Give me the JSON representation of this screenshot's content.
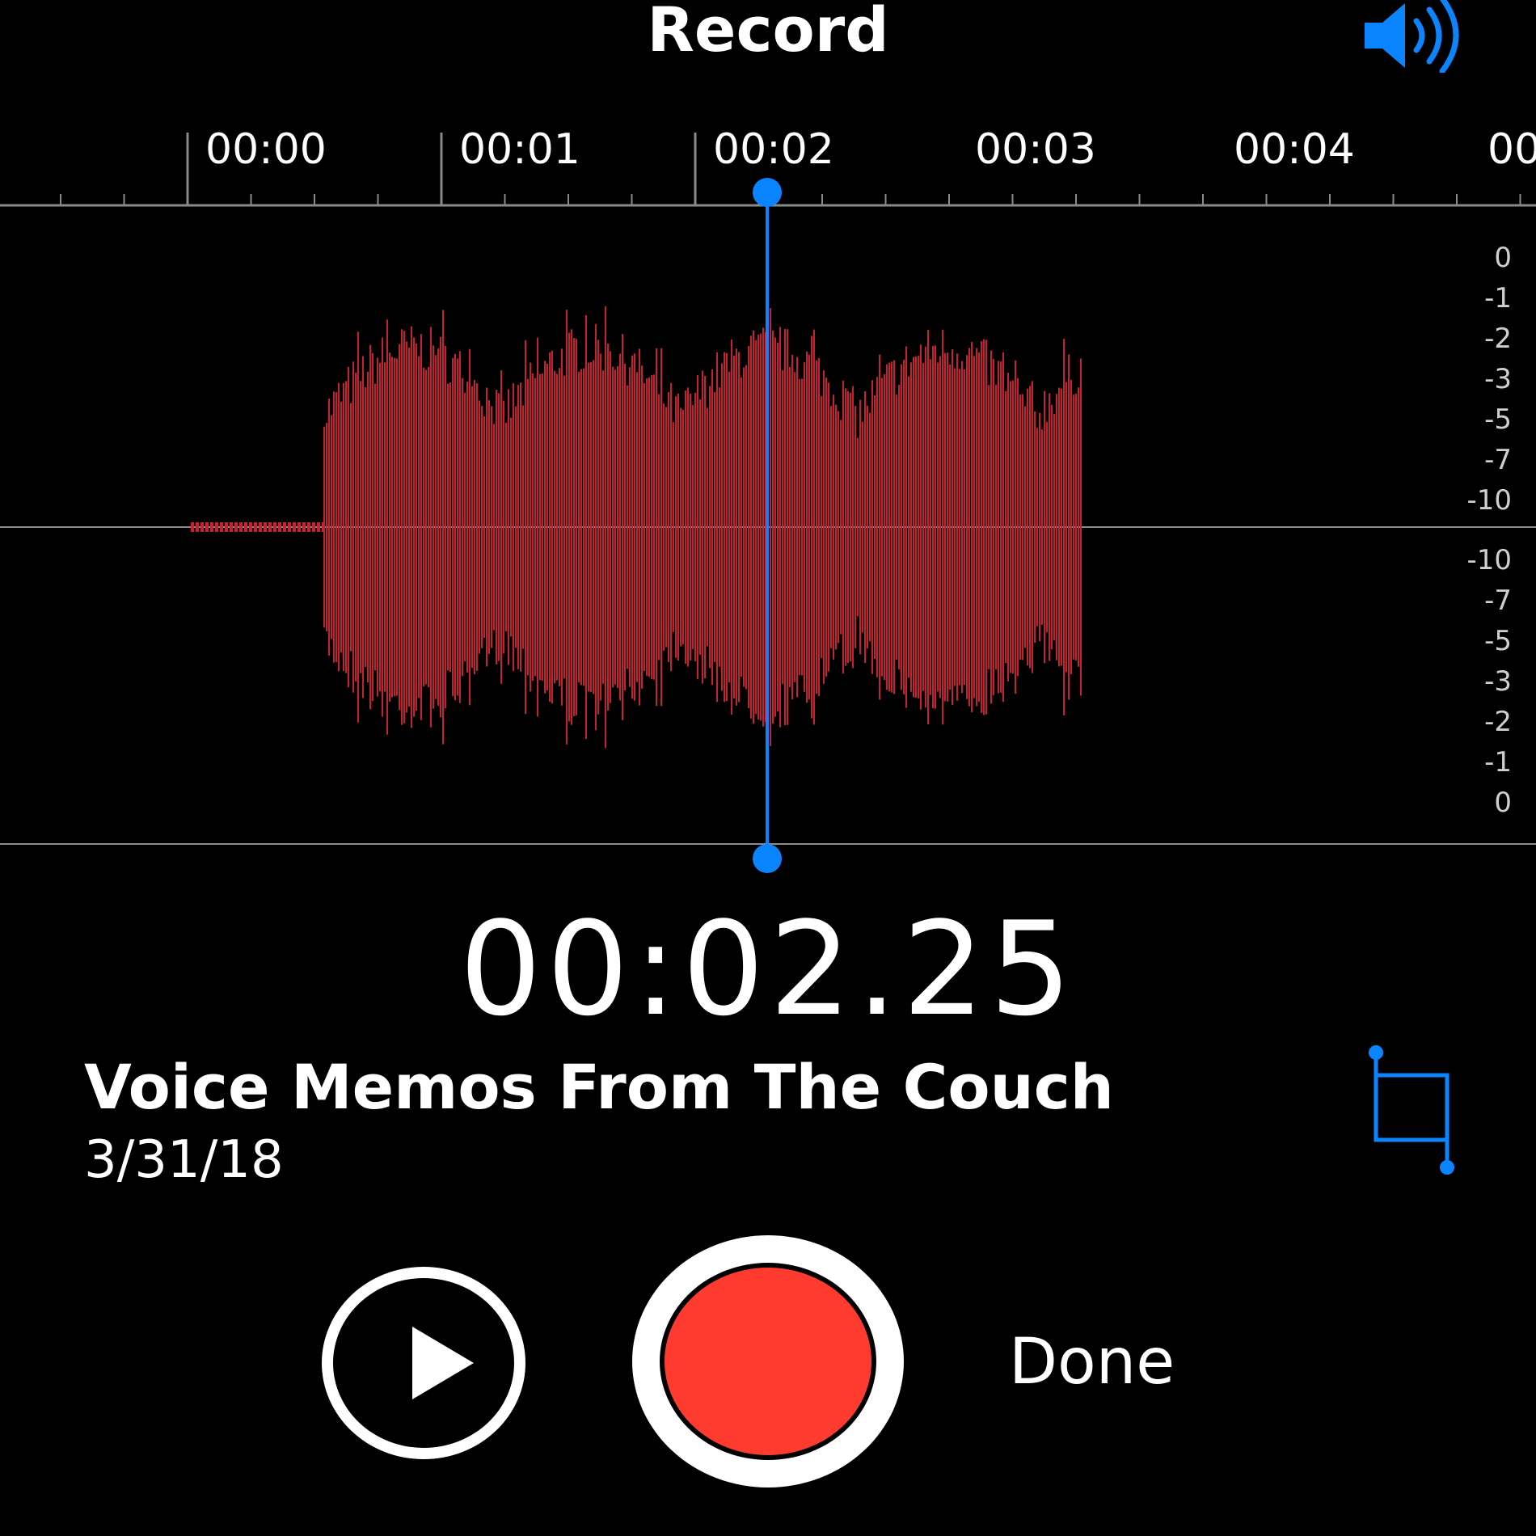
{
  "header": {
    "title": "Record",
    "speaker_icon": "speaker-volume-icon"
  },
  "timeline": {
    "ticks": [
      "00:00",
      "00:01",
      "00:02",
      "00:03",
      "00:04",
      "00"
    ],
    "playhead_time": "00:02.25"
  },
  "level_scale": {
    "top": [
      "0",
      "-1",
      "-2",
      "-3",
      "-5",
      "-7",
      "-10"
    ],
    "bottom": [
      "-10",
      "-7",
      "-5",
      "-3",
      "-2",
      "-1",
      "0"
    ]
  },
  "memo": {
    "title": "Voice Memos From The Couch",
    "date": "3/31/18",
    "trim_icon": "trim-crop-icon"
  },
  "controls": {
    "play_icon": "play-icon",
    "record_icon": "record-icon",
    "done_label": "Done"
  },
  "colors": {
    "accent": "#0a84ff",
    "waveform": "#c8202f",
    "record": "#ff3b30",
    "background": "#000000"
  }
}
